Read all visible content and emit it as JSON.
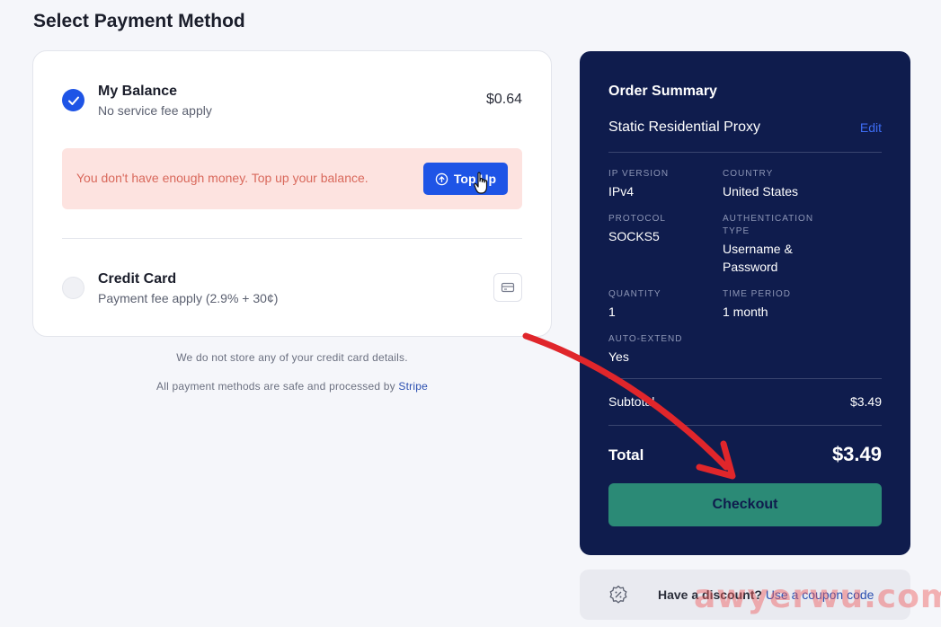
{
  "page": {
    "title": "Select Payment Method"
  },
  "payment": {
    "balance": {
      "title": "My Balance",
      "subtitle": "No service fee apply",
      "amount": "$0.64",
      "selected": true
    },
    "warning": {
      "text": "You don't have enough money. Top up your balance.",
      "button_label": "Top Up"
    },
    "credit_card": {
      "title": "Credit Card",
      "subtitle": "Payment fee apply (2.9% + 30¢)",
      "selected": false
    }
  },
  "notes": {
    "line1": "We do not store any of your credit card details.",
    "line2_prefix": "All payment methods are safe and processed by ",
    "line2_link": "Stripe"
  },
  "summary": {
    "title": "Order Summary",
    "product": "Static Residential Proxy",
    "edit_label": "Edit",
    "fields": [
      {
        "label": "IP VERSION",
        "value": "IPv4"
      },
      {
        "label": "COUNTRY",
        "value": "United States"
      },
      {
        "label": "PROTOCOL",
        "value": "SOCKS5"
      },
      {
        "label": "AUTHENTICATION TYPE",
        "value": "Username & Password"
      },
      {
        "label": "QUANTITY",
        "value": "1"
      },
      {
        "label": "TIME PERIOD",
        "value": "1 month"
      },
      {
        "label": "AUTO-EXTEND",
        "value": "Yes"
      }
    ],
    "subtotal_label": "Subtotal",
    "subtotal_value": "$3.49",
    "total_label": "Total",
    "total_value": "$3.49",
    "checkout_label": "Checkout"
  },
  "discount": {
    "question": "Have a discount? ",
    "link": "Use a coupon code"
  },
  "watermark": "awyerwu.com",
  "colors": {
    "accent": "#1e54e6",
    "summary_bg": "#0f1c4d",
    "checkout": "#2b8a76",
    "warning_bg": "#fde3e0",
    "annotation_arrow": "#e0262b"
  }
}
